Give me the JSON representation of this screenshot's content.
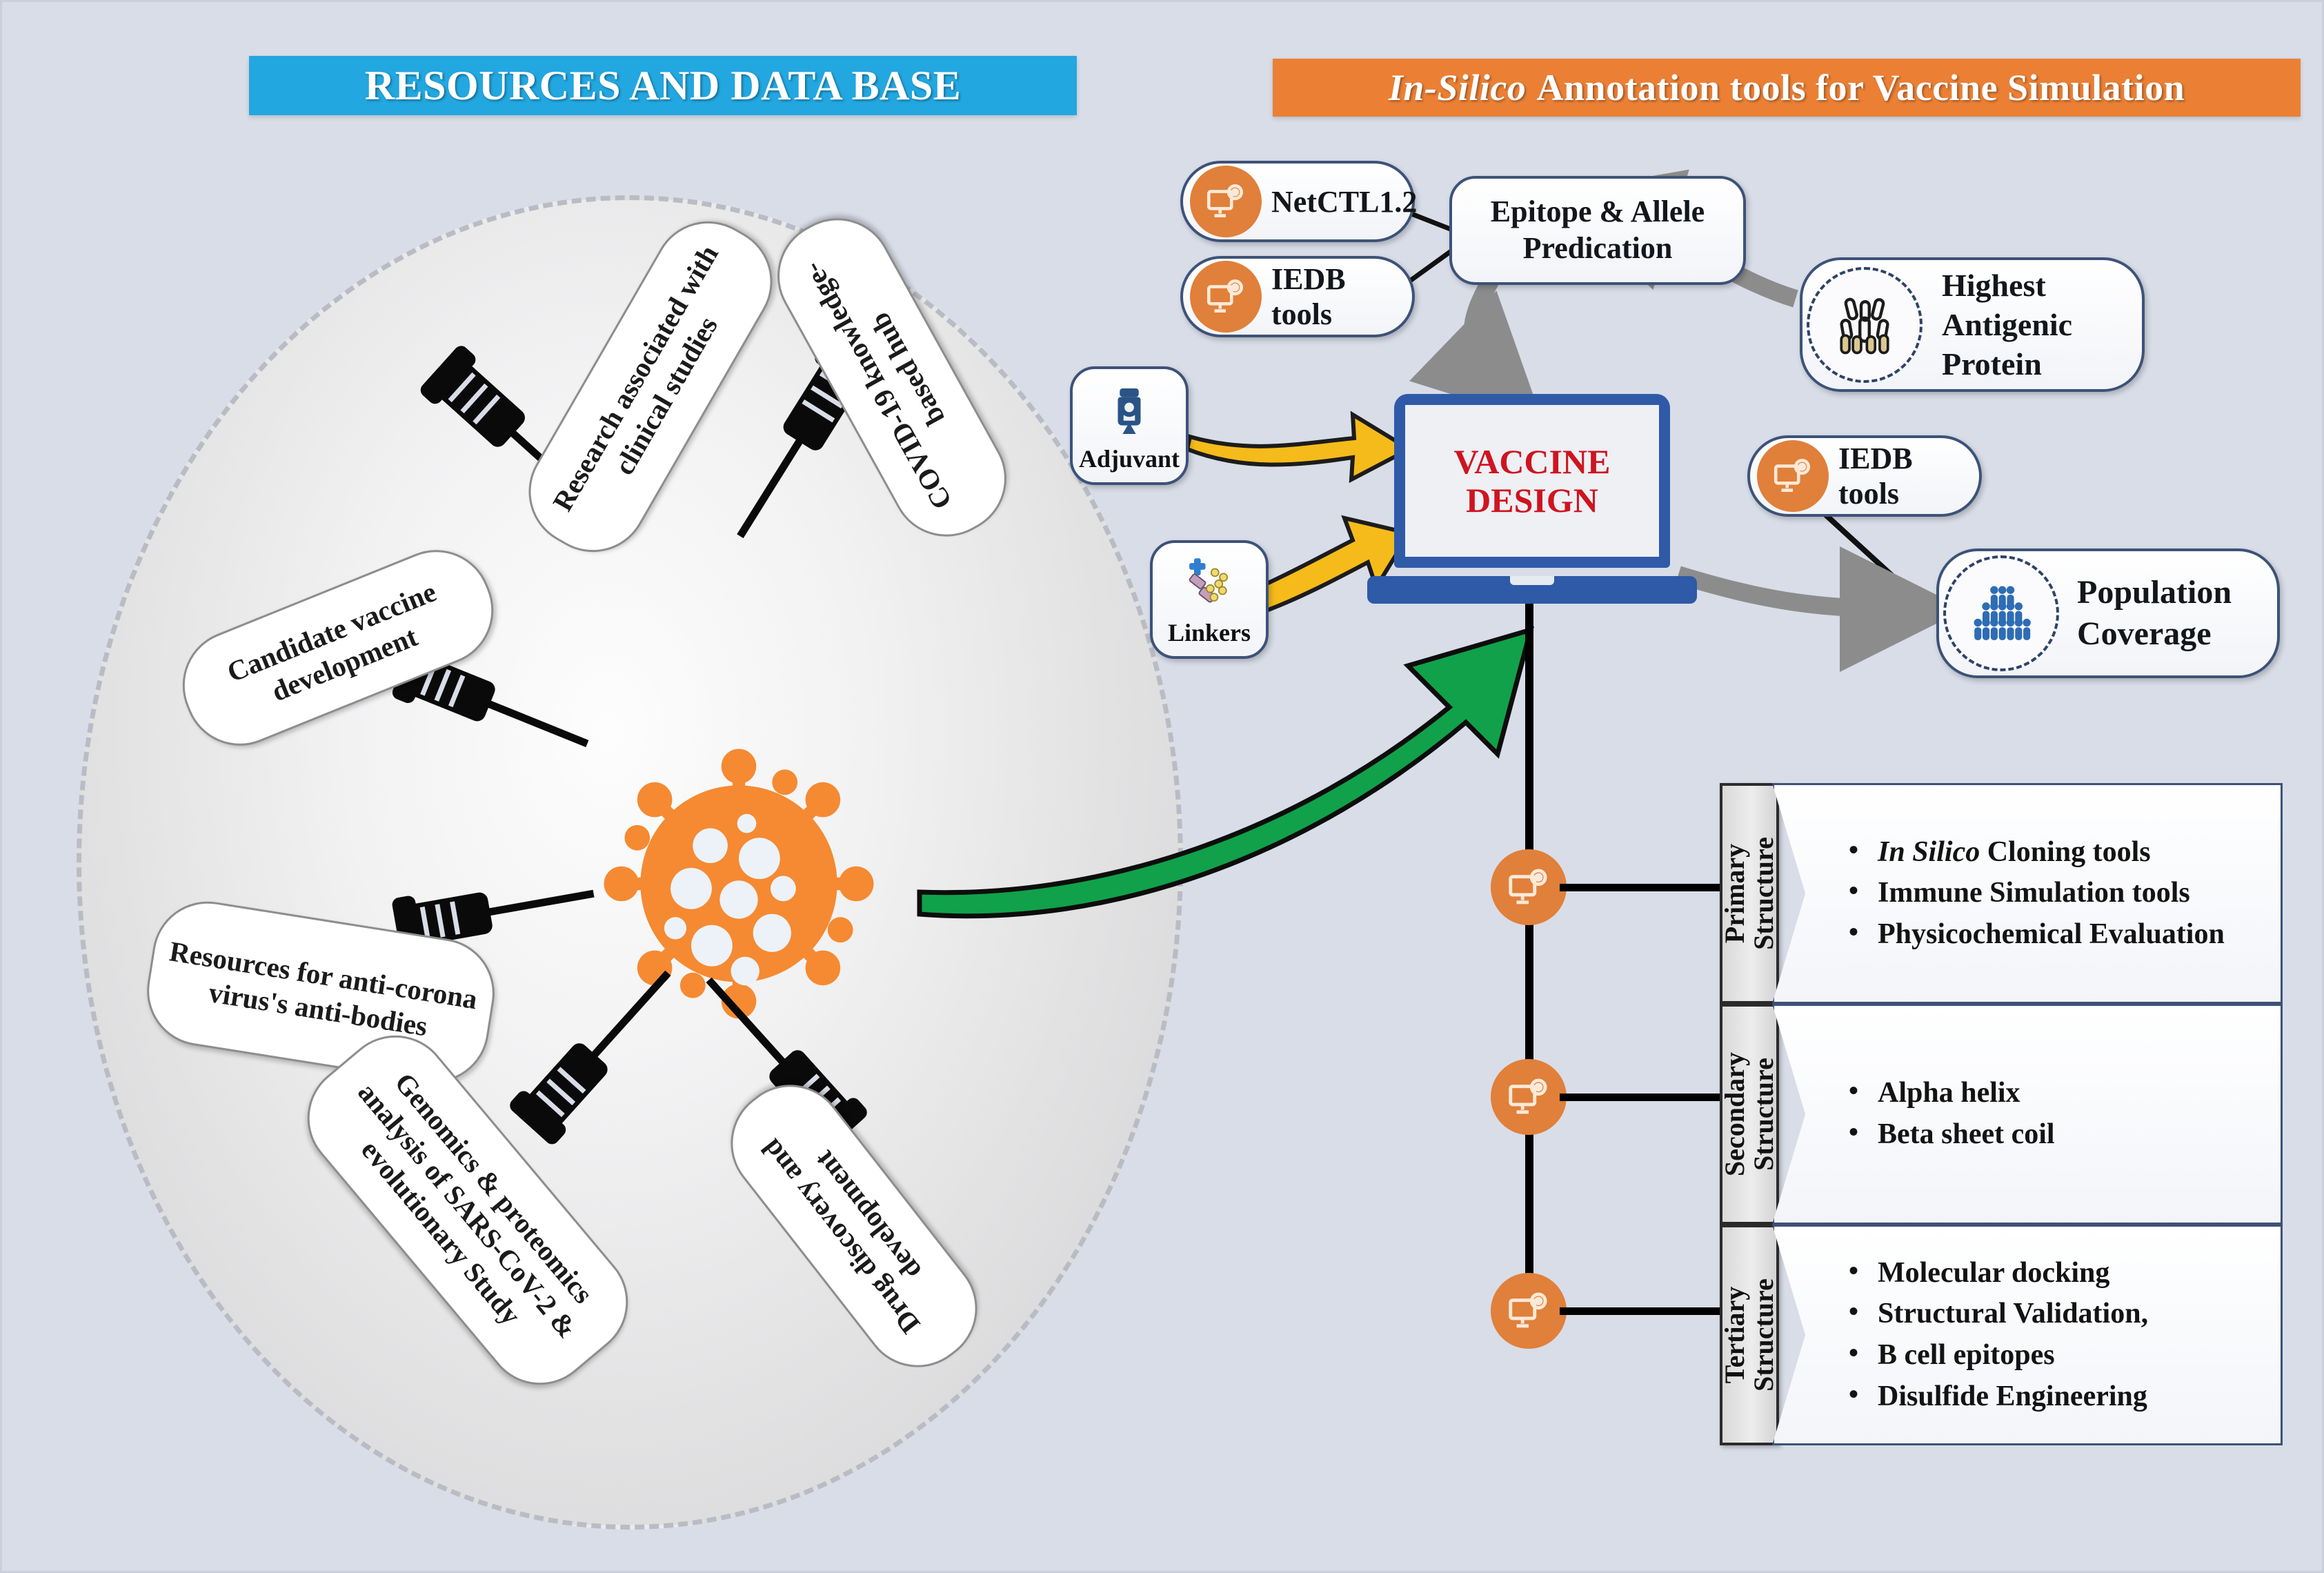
{
  "banners": {
    "left": "RESOURCES AND DATA BASE",
    "right_italic": "In-Silico",
    "right_rest": "Annotation tools for Vaccine Simulation"
  },
  "resources_panel": {
    "labels": [
      "Research associated with clinical studies",
      "COVID-19 knowledge-based hub",
      "Candidate vaccine development",
      "Resources for anti-corona virus's anti-bodies",
      "Genomics & proteomics analysis of SARS-CoV-2 & evolutionary Study",
      "Drug discovery and development"
    ],
    "center_icon": "coronavirus-icon",
    "syringe_icon": "syringe-icon"
  },
  "annotation_panel": {
    "tools": [
      {
        "label": "NetCTL1.2",
        "icon": "computer-gear-icon"
      },
      {
        "label": "IEDB tools",
        "icon": "computer-gear-icon"
      }
    ],
    "prediction_box": "Epitope & Allele Predication",
    "antigenic_node": {
      "label": "Highest Antigenic Protein",
      "icon": "antibody-icon"
    },
    "iedb_right": {
      "label": "IEDB tools",
      "icon": "computer-gear-icon"
    },
    "population_node": {
      "label": "Population Coverage",
      "icon": "people-group-icon"
    },
    "inputs": [
      {
        "label": "Adjuvant",
        "icon": "vaccine-vial-icon"
      },
      {
        "label": "Linkers",
        "icon": "molecule-linker-icon"
      }
    ],
    "laptop": {
      "line1": "VACCINE",
      "line2": "DESIGN",
      "icon": "laptop-icon"
    }
  },
  "structures": [
    {
      "band_line1": "Primary",
      "band_line2": "Structure",
      "icon": "computer-gear-icon",
      "items": [
        {
          "italic": "In Silico",
          "rest": "Cloning tools"
        },
        {
          "italic": "",
          "rest": "Immune Simulation tools"
        },
        {
          "italic": "",
          "rest": "Physicochemical Evaluation"
        }
      ]
    },
    {
      "band_line1": "Secondary",
      "band_line2": "Structure",
      "icon": "computer-gear-icon",
      "items": [
        {
          "italic": "",
          "rest": "Alpha helix"
        },
        {
          "italic": "",
          "rest": "Beta sheet coil"
        }
      ]
    },
    {
      "band_line1": "Tertiary",
      "band_line2": "Structure",
      "icon": "computer-gear-icon",
      "items": [
        {
          "italic": "",
          "rest": "Molecular docking"
        },
        {
          "italic": "",
          "rest": "Structural Validation,"
        },
        {
          "italic": "",
          "rest": "B cell epitopes"
        },
        {
          "italic": "",
          "rest": "Disulfide Engineering"
        }
      ]
    }
  ],
  "colors": {
    "background": "#d8dde8",
    "banner_left": "#22a7e0",
    "banner_right": "#eb8035",
    "virus_orange": "#f58a32",
    "laptop_blue": "#2f5aa8",
    "vaccine_text_red": "#cf1420",
    "green_arrow": "#11a14a",
    "yellow_arrow": "#f5bb1b",
    "grey_arrow": "#8c8c8c",
    "node_border": "#3d5278"
  }
}
